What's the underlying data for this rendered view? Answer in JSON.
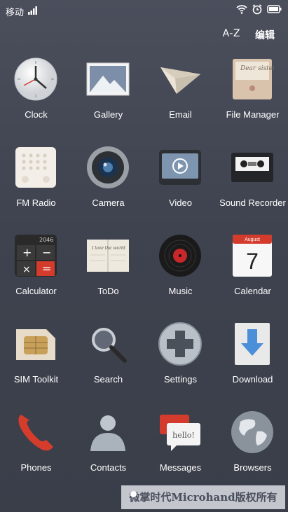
{
  "status_bar": {
    "carrier": "移动"
  },
  "top_bar": {
    "az_label": "A-Z",
    "edit_label": "编辑"
  },
  "apps": [
    {
      "label": "Clock",
      "icon": "clock-icon"
    },
    {
      "label": "Gallery",
      "icon": "gallery-icon"
    },
    {
      "label": "Email",
      "icon": "paper-plane-icon"
    },
    {
      "label": "File Manager",
      "icon": "folder-icon"
    },
    {
      "label": "FM Radio",
      "icon": "radio-icon"
    },
    {
      "label": "Camera",
      "icon": "camera-lens-icon"
    },
    {
      "label": "Video",
      "icon": "video-player-icon"
    },
    {
      "label": "Sound Recorder",
      "icon": "cassette-icon"
    },
    {
      "label": "Calculator",
      "icon": "calculator-icon"
    },
    {
      "label": "ToDo",
      "icon": "notebook-icon"
    },
    {
      "label": "Music",
      "icon": "vinyl-record-icon"
    },
    {
      "label": "Calendar",
      "icon": "calendar-icon"
    },
    {
      "label": "SIM Toolkit",
      "icon": "sim-card-icon"
    },
    {
      "label": "Search",
      "icon": "magnifier-icon"
    },
    {
      "label": "Settings",
      "icon": "settings-icon"
    },
    {
      "label": "Download",
      "icon": "download-arrow-icon"
    },
    {
      "label": "Phones",
      "icon": "phone-handset-icon"
    },
    {
      "label": "Contacts",
      "icon": "contact-person-icon"
    },
    {
      "label": "Messages",
      "icon": "speech-bubble-icon"
    },
    {
      "label": "Browsers",
      "icon": "globe-icon"
    }
  ],
  "calendar_icon": {
    "month": "August",
    "day": "7"
  },
  "calculator_icon": {
    "display": "2046"
  },
  "todo_icon": {
    "text": "I love the world"
  },
  "file_icon": {
    "text": "Dear sister"
  },
  "messages_icon": {
    "text": "hello!"
  },
  "watermark": "微掌时代Microhand版权所有",
  "colors": {
    "background": "#43474f",
    "accent_red": "#d33b2c"
  }
}
